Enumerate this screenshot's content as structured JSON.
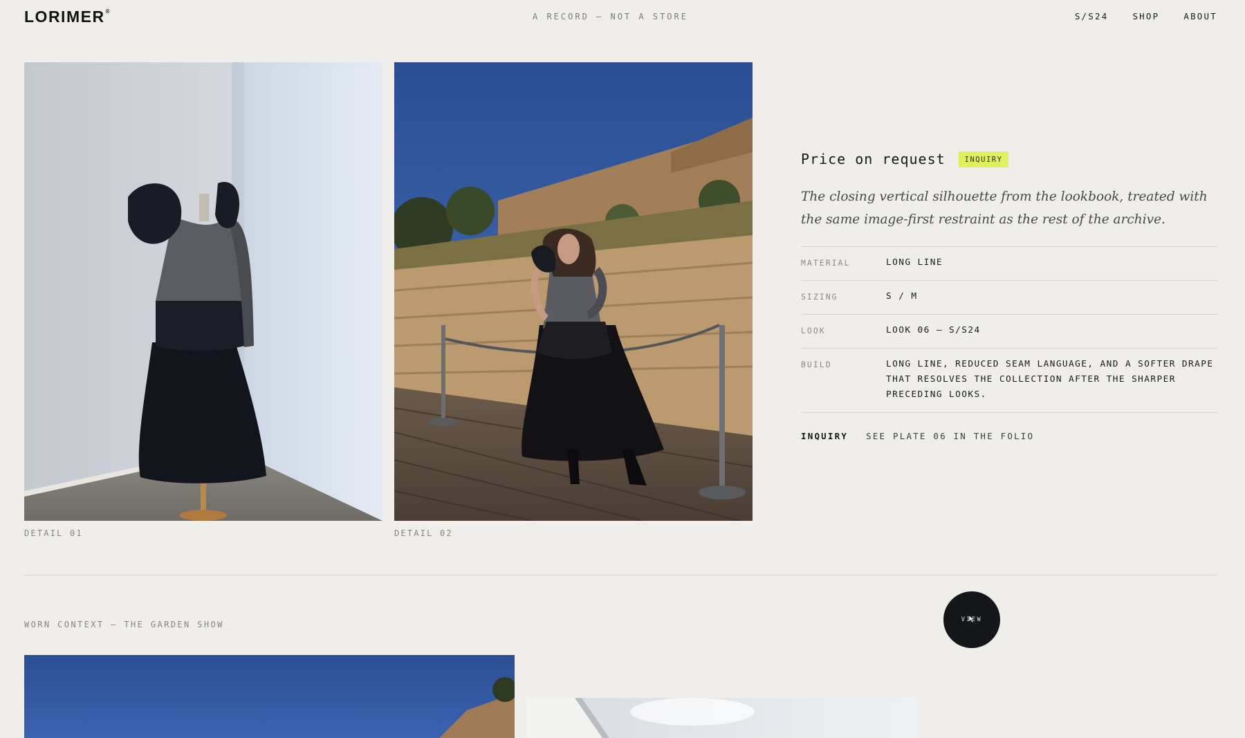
{
  "header": {
    "logo": "LORIMER",
    "logo_mark": "®",
    "tagline": "A RECORD — NOT A STORE",
    "nav": [
      {
        "label": "S/S24"
      },
      {
        "label": "SHOP"
      },
      {
        "label": "ABOUT"
      }
    ]
  },
  "gallery": {
    "captions": [
      "DETAIL 01",
      "DETAIL 02"
    ]
  },
  "product": {
    "price": "Price on request",
    "badge": "INQUIRY",
    "description": "The closing vertical silhouette from the lookbook, treated with the same image-first restraint as the rest of the archive.",
    "specs": [
      {
        "label": "MATERIAL",
        "value": "LONG LINE"
      },
      {
        "label": "SIZING",
        "value": "S / M"
      },
      {
        "label": "LOOK",
        "value": "LOOK 06 — S/S24"
      },
      {
        "label": "BUILD",
        "value": "LONG LINE, REDUCED SEAM LANGUAGE, AND A SOFTER DRAPE THAT RESOLVES THE COLLECTION AFTER THE SHARPER PRECEDING LOOKS."
      }
    ],
    "inquiry_label": "INQUIRY",
    "inquiry_text": "SEE PLATE 06 IN THE FOLIO"
  },
  "section": {
    "label": "WORN CONTEXT — THE GARDEN SHOW",
    "cursor_label": "VIEW"
  },
  "colors": {
    "background": "#efeeea",
    "badge": "#dff05a",
    "cursor": "#14161a",
    "text": "#161616"
  }
}
